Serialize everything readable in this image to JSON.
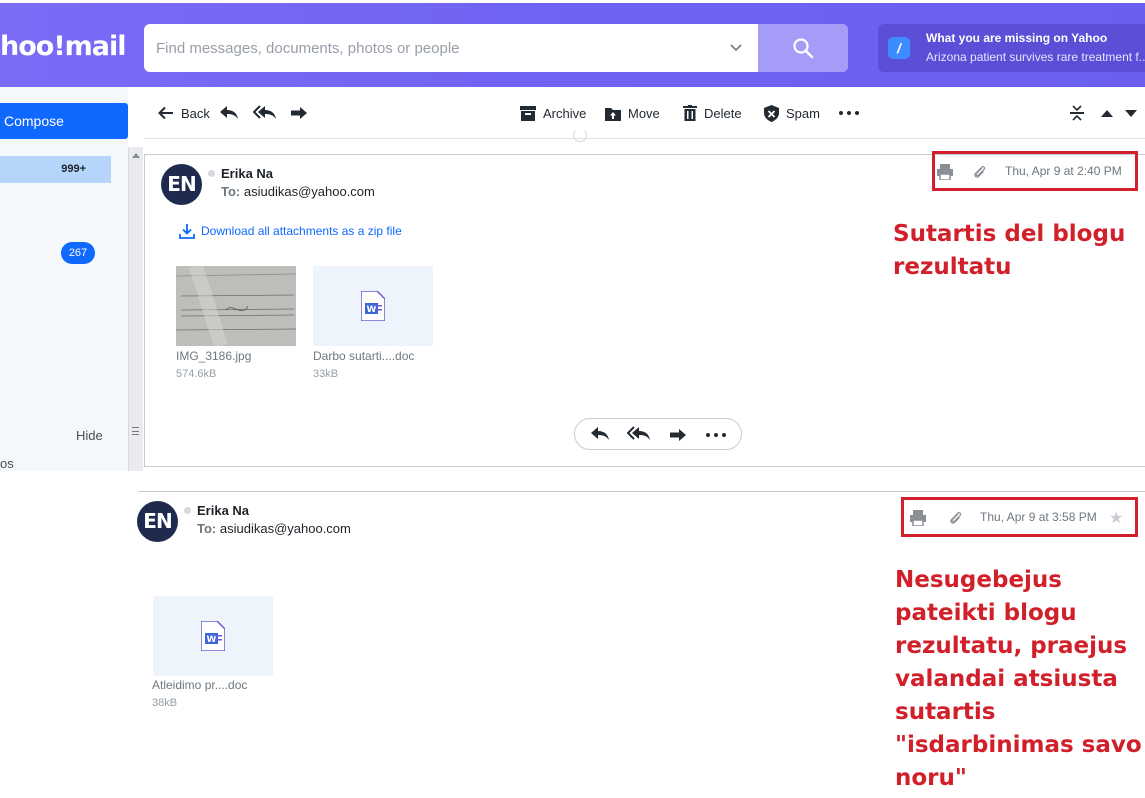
{
  "header": {
    "logo_text": "hoo!mail",
    "search_placeholder": "Find messages, documents, photos or people",
    "promo_title": "What you are missing on Yahoo",
    "promo_subtitle": "Arizona patient survives rare treatment f..."
  },
  "sidebar": {
    "compose_label": "Compose",
    "inbox_count": "999+",
    "folder_badge": "267",
    "hide_label": "Hide",
    "cut_label": "os"
  },
  "toolbar": {
    "back": "Back",
    "archive": "Archive",
    "move": "Move",
    "delete": "Delete",
    "spam": "Spam"
  },
  "emails": [
    {
      "avatar": "EN",
      "sender": "Erika Na",
      "to_label": "To:",
      "to_address": "asiudikas@yahoo.com",
      "date": "Thu, Apr 9 at 2:40 PM",
      "download_all": "Download all attachments as a zip file",
      "attachments": [
        {
          "name": "IMG_3186.jpg",
          "size": "574.6kB"
        },
        {
          "name": "Darbo sutarti....doc",
          "size": "33kB"
        }
      ]
    },
    {
      "avatar": "EN",
      "sender": "Erika Na",
      "to_label": "To:",
      "to_address": "asiudikas@yahoo.com",
      "date": "Thu, Apr 9 at 3:58 PM",
      "attachments": [
        {
          "name": "Atleidimo pr....doc",
          "size": "38kB"
        }
      ]
    }
  ],
  "annotations": {
    "first": [
      "Sutartis del blogu",
      "rezultatu"
    ],
    "second": [
      "Nesugebejus",
      "pateikti blogu",
      "rezultatu, praejus",
      "valandai atsiusta",
      "sutartis",
      "\"isdarbinimas savo",
      "noru\""
    ]
  },
  "colors": {
    "header_gradient": "#7b6cf6",
    "accent": "#0f69ff",
    "annotation_red": "#d2202b"
  }
}
